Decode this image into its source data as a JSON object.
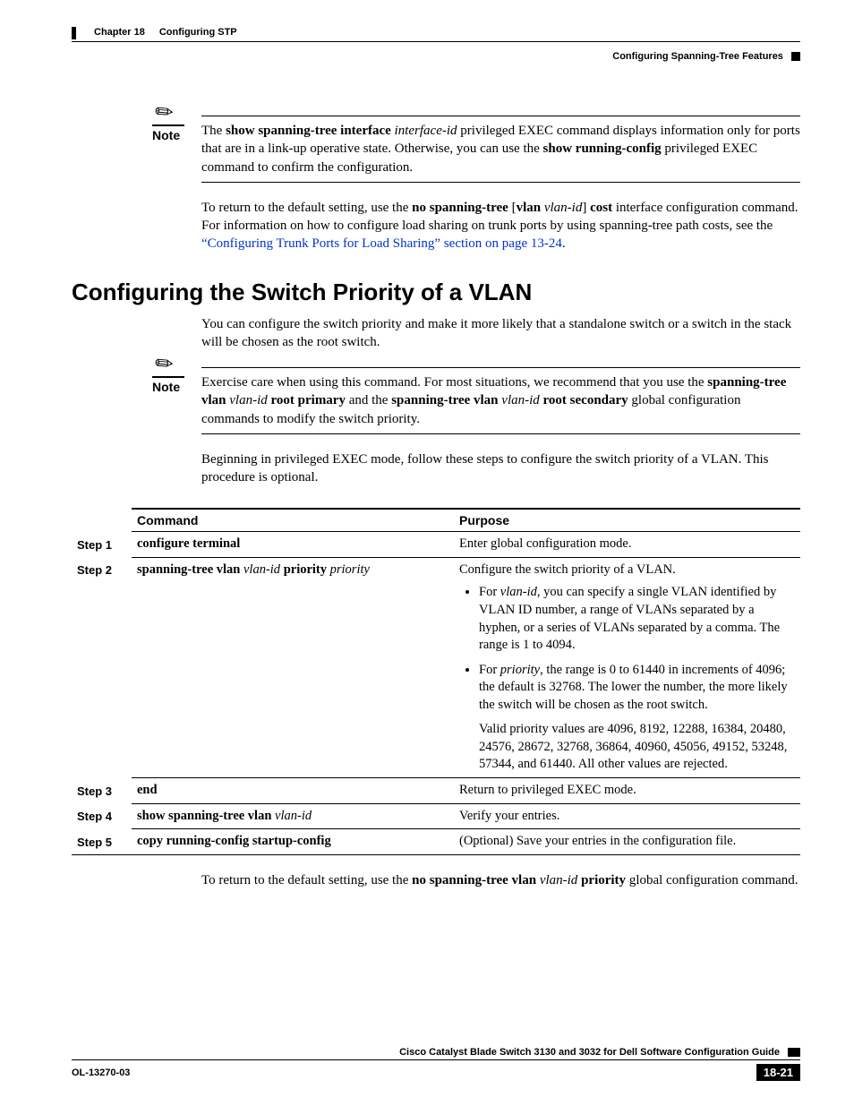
{
  "header": {
    "chapter": "Chapter 18",
    "title": "Configuring STP",
    "section": "Configuring Spanning-Tree Features"
  },
  "note1": {
    "label": "Note",
    "text_parts": [
      "The ",
      "show spanning-tree interface ",
      "interface-id",
      " privileged EXEC command displays information only for ports that are in a link-up operative state. Otherwise, you can use the ",
      "show running-config",
      " privileged EXEC command to confirm the configuration."
    ]
  },
  "para1": {
    "pre": "To return to the default setting, use the ",
    "b1": "no spanning-tree",
    "mid1": " [",
    "b2": "vlan",
    "sp": " ",
    "i1": "vlan-id",
    "mid2": "] ",
    "b3": "cost",
    "post": " interface configuration command. For information on how to configure load sharing on trunk ports by using spanning-tree path costs, see the ",
    "link": "“Configuring Trunk Ports for Load Sharing” section on page 13-24",
    "end": "."
  },
  "section_heading": "Configuring the Switch Priority of a VLAN",
  "para2": "You can configure the switch priority and make it more likely that a standalone switch or a switch in the stack will be chosen as the root switch.",
  "note2": {
    "label": "Note",
    "pre": "Exercise care when using this command. For most situations, we recommend that you use the ",
    "b1": "spanning-tree vlan",
    "sp1": " ",
    "i1": "vlan-id",
    "sp2": " ",
    "b2": "root primary",
    "mid": " and the ",
    "b3": "spanning-tree vlan",
    "sp3": " ",
    "i2": "vlan-id",
    "sp4": " ",
    "b4": "root secondary",
    "post": " global configuration commands to modify the switch priority."
  },
  "para3": "Beginning in privileged EXEC mode, follow these steps to configure the switch priority of a VLAN. This procedure is optional.",
  "table": {
    "headers": {
      "command": "Command",
      "purpose": "Purpose"
    },
    "steps": [
      {
        "step": "Step 1",
        "command_parts": {
          "b": "configure terminal"
        },
        "purpose_plain": "Enter global configuration mode."
      },
      {
        "step": "Step 2",
        "command_parts": {
          "b1": "spanning-tree vlan",
          "sp1": " ",
          "i1": "vlan-id",
          "sp2": " ",
          "b2": "priority",
          "sp3": " ",
          "i2": "priority"
        },
        "purpose_intro": "Configure the switch priority of a VLAN.",
        "bullet1": {
          "pre": "For ",
          "i": "vlan-id",
          "post": ", you can specify a single VLAN identified by VLAN ID number, a range of VLANs separated by a hyphen, or a series of VLANs separated by a comma. The range is 1 to 4094."
        },
        "bullet2": {
          "pre": "For ",
          "i": "priority",
          "post": ", the range is 0 to 61440 in increments of 4096; the default is 32768. The lower the number, the more likely the switch will be chosen as the root switch."
        },
        "valid": "Valid priority values are 4096, 8192, 12288, 16384, 20480, 24576, 28672, 32768, 36864, 40960, 45056, 49152, 53248, 57344, and 61440. All other values are rejected."
      },
      {
        "step": "Step 3",
        "command_parts": {
          "b": "end"
        },
        "purpose_plain": "Return to privileged EXEC mode."
      },
      {
        "step": "Step 4",
        "command_parts": {
          "b": "show spanning-tree vlan",
          "sp": " ",
          "i": "vlan-id"
        },
        "purpose_plain": "Verify your entries."
      },
      {
        "step": "Step 5",
        "command_parts": {
          "b": "copy running-config startup-config"
        },
        "purpose_plain": "(Optional) Save your entries in the configuration file."
      }
    ]
  },
  "para4": {
    "pre": "To return to the default setting, use the ",
    "b1": "no spanning-tree vlan",
    "sp": " ",
    "i1": "vlan-id",
    "sp2": " ",
    "b2": "priority",
    "post": " global configuration command."
  },
  "footer": {
    "guide": "Cisco Catalyst Blade Switch 3130 and 3032 for Dell Software Configuration Guide",
    "doc": "OL-13270-03",
    "page": "18-21"
  }
}
